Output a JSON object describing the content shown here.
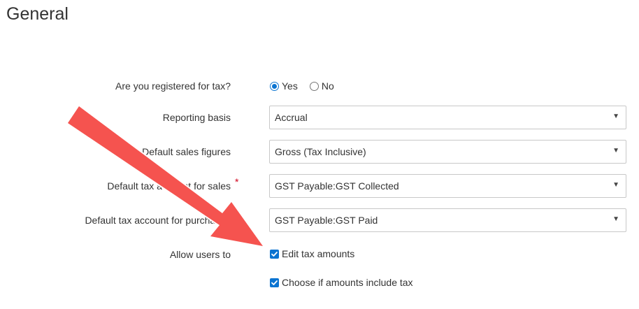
{
  "section_title": "General",
  "registered": {
    "label": "Are you registered for tax?",
    "options": [
      {
        "label": "Yes",
        "selected": true
      },
      {
        "label": "No",
        "selected": false
      }
    ]
  },
  "reporting_basis": {
    "label": "Reporting basis",
    "value": "Accrual"
  },
  "sales_figures": {
    "label": "Default sales figures",
    "value": "Gross (Tax Inclusive)"
  },
  "tax_account_sales": {
    "label": "Default tax account for sales",
    "required_mark": "*",
    "value": "GST Payable:GST Collected"
  },
  "tax_account_purchases": {
    "label": "Default tax account for purchases",
    "value": "GST Payable:GST Paid"
  },
  "allow_users": {
    "label": "Allow users to",
    "options": [
      {
        "label": "Edit tax amounts",
        "checked": true
      },
      {
        "label": "Choose if amounts include tax",
        "checked": true
      }
    ]
  },
  "icons": {
    "caret": "▼",
    "annotation": "red-arrow-annotation"
  },
  "colors": {
    "accent": "#0b74d1",
    "arrow": "#f5534f",
    "required": "#d0021b"
  }
}
